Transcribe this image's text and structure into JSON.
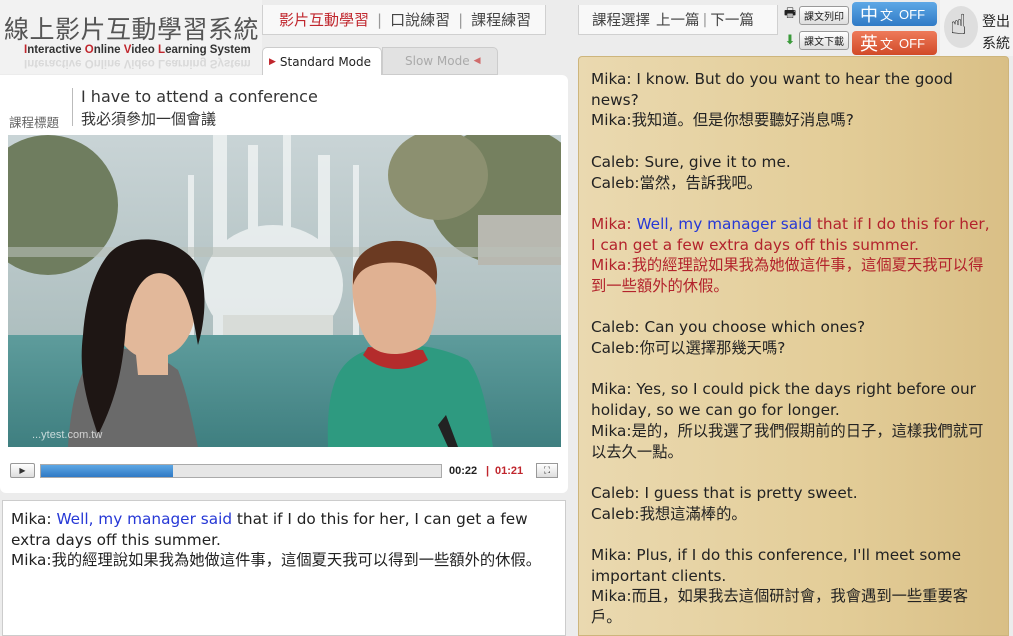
{
  "app": {
    "title": "線上影片互動學習系統",
    "subtitle_parts": [
      "I",
      "nteractive ",
      "O",
      "nline ",
      "V",
      "ideo ",
      "L",
      "earning System"
    ]
  },
  "nav": {
    "tab_video": "影片互動學習",
    "tab_speaking": "口說練習",
    "tab_exercise": "課程練習",
    "sep": "|"
  },
  "modes": {
    "standard": "Standard Mode",
    "slow": "Slow Mode"
  },
  "lesson": {
    "label": "課程標題",
    "title_en": "I have to attend a conference",
    "title_zh": "我必須參加一個會議"
  },
  "video": {
    "watermark": "...ytest.com.tw",
    "current_time": "00:22",
    "sep": "|",
    "total_time": "01:21",
    "progress": 0.33
  },
  "subtitle": {
    "speaker_en": "Mika: ",
    "highlight": "Well, my manager said",
    "rest_en": " that if I do this for her, I can get a few extra days off this summer.",
    "line_zh": "Mika:我的經理說如果我為她做這件事，這個夏天我可以得到一些額外的休假。"
  },
  "course_nav": {
    "select": "課程選擇",
    "prev": "上一篇",
    "next": "下一篇",
    "sep": "|"
  },
  "tools": {
    "print": "課文列印",
    "download": "課文下載"
  },
  "toggles": {
    "zh_big": "中",
    "zh_small": "文",
    "zh_state": "OFF",
    "en_big": "英",
    "en_small": "文",
    "en_state": "OFF"
  },
  "logout": {
    "label": "登出系統"
  },
  "transcript": [
    {
      "en": "Mika: I know. But do you want to hear the good news?",
      "zh": "Mika:我知道。但是你想要聽好消息嗎?"
    },
    {
      "en": "Caleb: Sure, give it to me.",
      "zh": "Caleb:當然，告訴我吧。"
    },
    {
      "en_speaker": "Mika: ",
      "en_highlight": "Well, my manager said",
      "en_rest": " that if I do this for her, I can get a few extra days off this summer.",
      "zh": "Mika:我的經理說如果我為她做這件事，這個夏天我可以得到一些額外的休假。"
    },
    {
      "en": "Caleb: Can you choose which ones?",
      "zh": "Caleb:你可以選擇那幾天嗎?"
    },
    {
      "en": "Mika: Yes, so I could pick the days right before our holiday, so we can go for longer.",
      "zh": "Mika:是的，所以我選了我們假期前的日子，這樣我們就可以去久一點。"
    },
    {
      "en": "Caleb: I guess that is pretty sweet.",
      "zh": "Caleb:我想這滿棒的。"
    },
    {
      "en": "Mika: Plus, if I do this conference, I'll meet some important clients.",
      "zh": "Mika:而且，如果我去這個研討會，我會遇到一些重要客戶。"
    }
  ],
  "colors": {
    "accent_red": "#c0262d",
    "highlight_blue": "#2638d6",
    "transcript_bg": "#e3cd98"
  }
}
